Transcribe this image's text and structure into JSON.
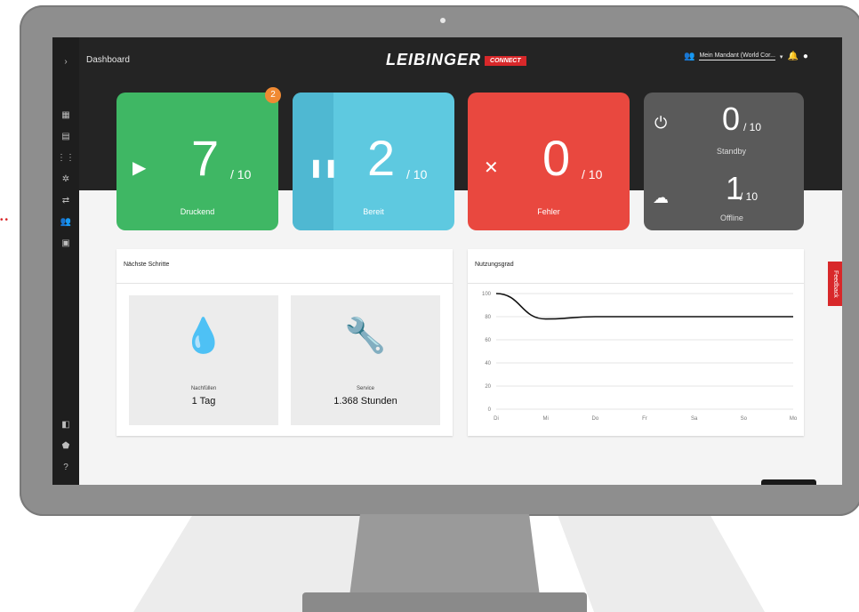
{
  "app": {
    "title": "Dashboard",
    "logo_text": "LEIBINGER",
    "logo_badge": "CONNECT",
    "tenant": "Mein Mandant (World Cor..."
  },
  "cards": [
    {
      "value": "7",
      "of": "/ 10",
      "label": "Druckend",
      "icon": "play-icon",
      "badge": "2"
    },
    {
      "value": "2",
      "of": "/ 10",
      "label": "Bereit",
      "icon": "pause-icon"
    },
    {
      "value": "0",
      "of": "/ 10",
      "label": "Fehler",
      "icon": "close-icon"
    }
  ],
  "status_card": {
    "standby_value": "0",
    "standby_of": "/ 10",
    "standby_label": "Standby",
    "offline_value": "1",
    "offline_of": "/ 10",
    "offline_label": "Offline"
  },
  "next_steps": {
    "title": "Nächste Schritte",
    "items": [
      {
        "label": "Nachfüllen",
        "value": "1 Tag",
        "icon": "drop-icon"
      },
      {
        "label": "Service",
        "value": "1.368 Stunden",
        "icon": "wrench-icon"
      }
    ]
  },
  "usage": {
    "title": "Nutzungsgrad"
  },
  "feedback_label": "Feedback",
  "colors": {
    "green": "#3fb764",
    "blue": "#5ec9e0",
    "red": "#e9483f",
    "grey": "#5a5a5a",
    "brand_red": "#d8282a"
  },
  "chart_data": {
    "type": "line",
    "title": "Nutzungsgrad",
    "categories": [
      "Di",
      "Mi",
      "Do",
      "Fr",
      "Sa",
      "So",
      "Mo"
    ],
    "series": [
      {
        "values": [
          100,
          78,
          80,
          80,
          80,
          80,
          80
        ]
      }
    ],
    "y_ticks": [
      "100",
      "80",
      "60",
      "40",
      "20",
      "0"
    ],
    "ylim": [
      0,
      100
    ],
    "grid": true
  }
}
